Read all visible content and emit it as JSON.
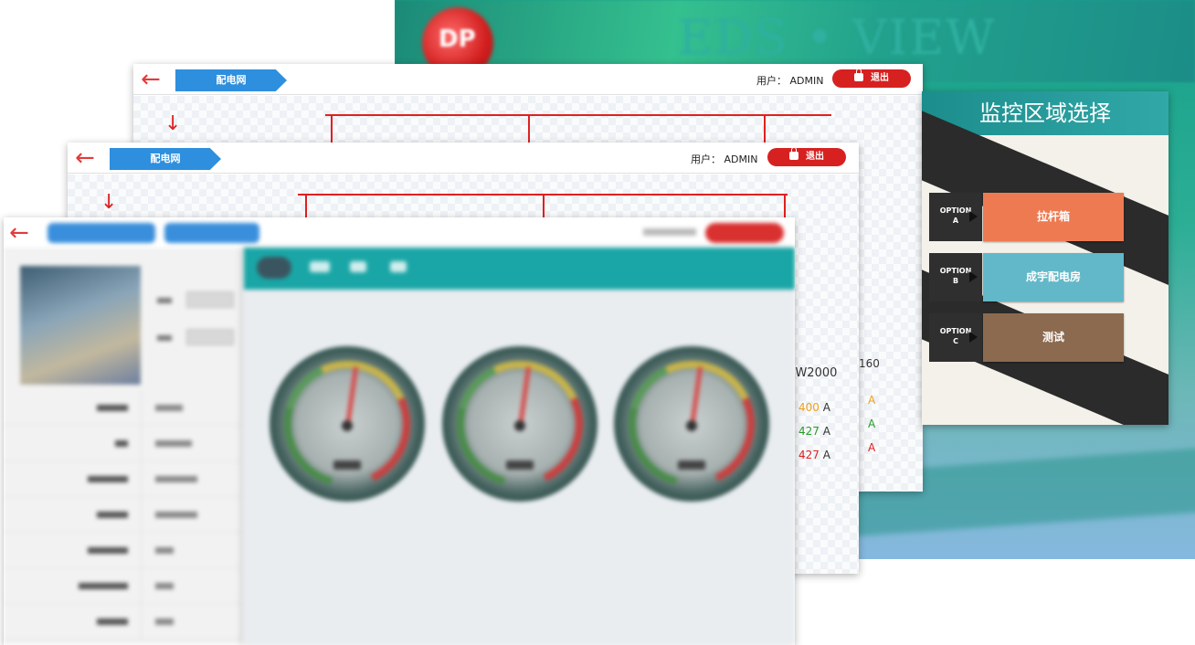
{
  "background_app": {
    "brand": "EDS • VIEW",
    "logo_text": "DP"
  },
  "region_dialog": {
    "title": "监控区域选择",
    "options": [
      {
        "tag_line1": "OPTION",
        "tag_line2": "A",
        "label": "拉杆箱",
        "color": "#ee7a52"
      },
      {
        "tag_line1": "OPTION",
        "tag_line2": "B",
        "label": "成宇配电房",
        "color": "#62b8c8"
      },
      {
        "tag_line1": "OPTION",
        "tag_line2": "C",
        "label": "测试",
        "color": "#8c6a4f"
      }
    ]
  },
  "network_window_back": {
    "breadcrumb": "配电网",
    "user_label": "用户：",
    "user_name": "ADMIN",
    "logout_label": "退出",
    "readings": {
      "model": "160",
      "values": [
        "A",
        "A",
        "A"
      ]
    }
  },
  "network_window_front": {
    "breadcrumb": "配电网",
    "user_label": "用户：",
    "user_name": "ADMIN",
    "logout_label": "退出",
    "readings": {
      "model": "BW2000",
      "values": [
        {
          "value": "400",
          "unit": "A",
          "color": "#f0a020"
        },
        {
          "value": "427",
          "unit": "A",
          "color": "#2a9a2a"
        },
        {
          "value": "427",
          "unit": "A",
          "color": "#e02020"
        }
      ]
    }
  },
  "accent_colors": {
    "bus_line": "#e02020",
    "breadcrumb": "#2e8fde",
    "logout": "#d72121",
    "gauge_header": "#1aa6a6"
  },
  "icons": {
    "back": "left-arrow-icon",
    "feeder": "down-arrow-icon",
    "lock": "lock-icon"
  }
}
